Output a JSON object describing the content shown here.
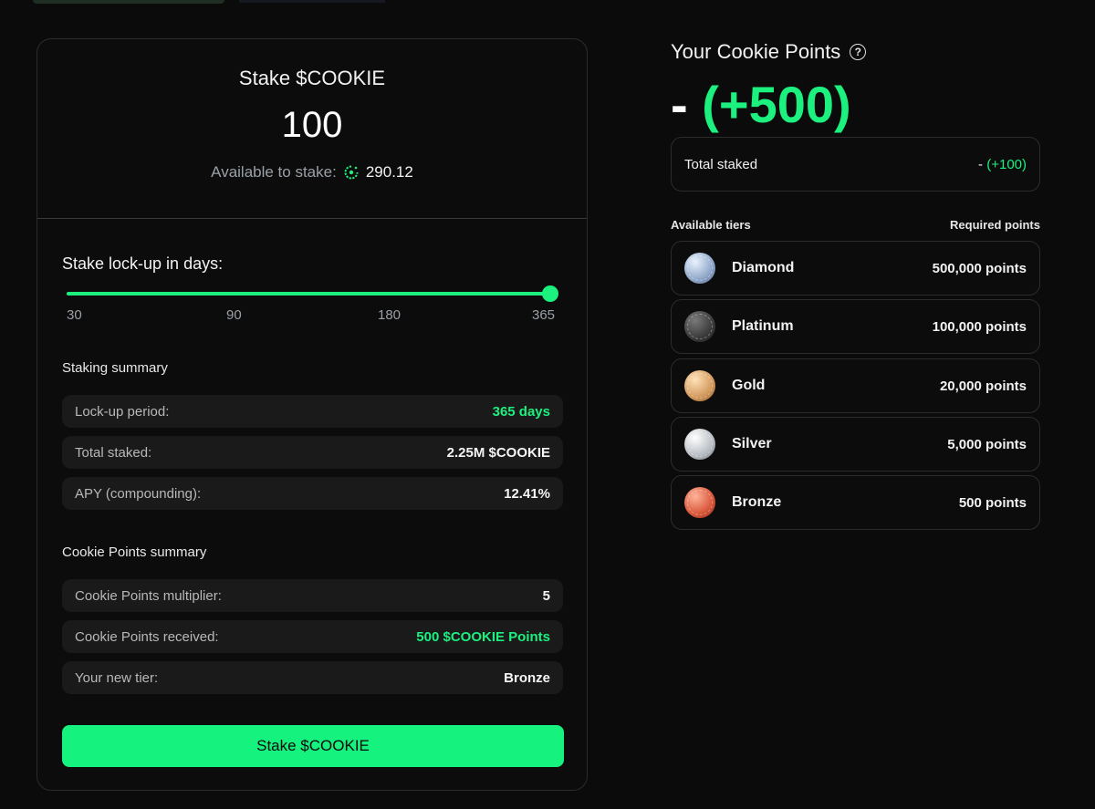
{
  "stake": {
    "title": "Stake $COOKIE",
    "amount": "100",
    "available_label": "Available to stake:",
    "available_value": "290.12"
  },
  "lockup": {
    "title": "Stake lock-up in days:",
    "ticks": [
      "30",
      "90",
      "180",
      "365"
    ],
    "selected_days": 365
  },
  "staking_summary": {
    "title": "Staking summary",
    "rows": [
      {
        "label": "Lock-up period:",
        "value": "365 days"
      },
      {
        "label": "Total staked:",
        "value": "2.25M $COOKIE"
      },
      {
        "label": "APY (compounding):",
        "value": "12.41%"
      }
    ]
  },
  "points_summary": {
    "title": "Cookie Points summary",
    "rows": [
      {
        "label": "Cookie Points multiplier:",
        "value": "5"
      },
      {
        "label": "Cookie Points received:",
        "value": "500 $COOKIE Points"
      },
      {
        "label": "Your new tier:",
        "value": "Bronze"
      }
    ]
  },
  "stake_button": "Stake $COOKIE",
  "cookie_points": {
    "title": "Your Cookie Points",
    "value_dash": "-",
    "value_plus": "(+500)",
    "total_label": "Total staked",
    "total_dash": "- ",
    "total_plus": "(+100)"
  },
  "tiers": {
    "header_left": "Available tiers",
    "header_right": "Required points",
    "items": [
      {
        "name": "Diamond",
        "points": "500,000 points"
      },
      {
        "name": "Platinum",
        "points": "100,000 points"
      },
      {
        "name": "Gold",
        "points": "20,000 points"
      },
      {
        "name": "Silver",
        "points": "5,000 points"
      },
      {
        "name": "Bronze",
        "points": "500 points"
      }
    ]
  },
  "colors": {
    "accent": "#1cf07f",
    "background": "#0b0b0b",
    "row_bg": "#1a1a1a"
  }
}
